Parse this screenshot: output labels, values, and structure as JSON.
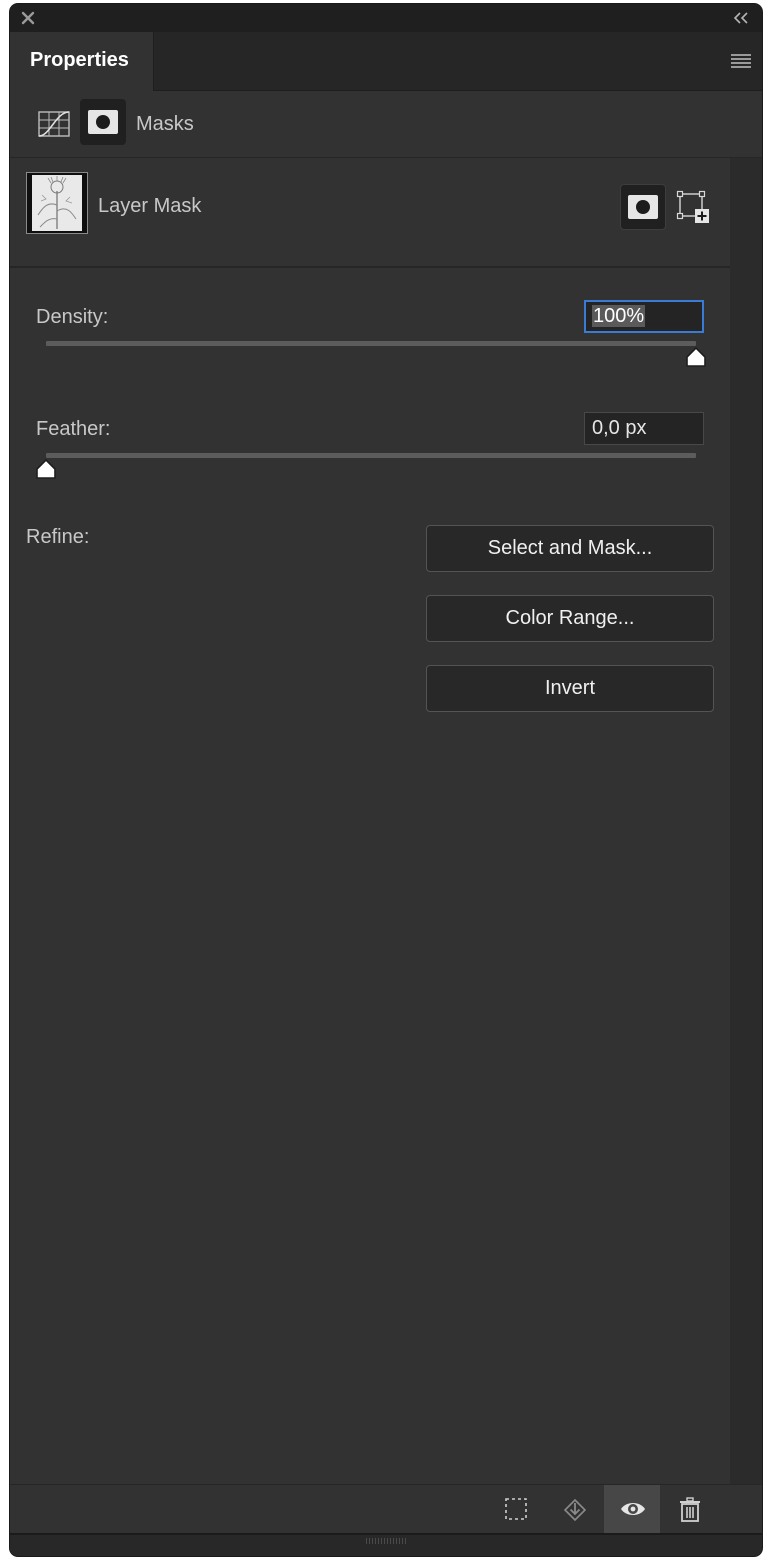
{
  "panel": {
    "tab_title": "Properties",
    "section_label": "Masks"
  },
  "icons": {
    "close": "close-icon",
    "collapse": "double-chevron-left-icon",
    "menu": "hamburger-menu-icon",
    "adjustments": "curves-adjustment-icon",
    "pixel_mask": "pixel-mask-icon",
    "vector_mask": "vector-mask-add-icon",
    "load_selection": "load-selection-icon",
    "apply_mask": "apply-mask-icon",
    "visibility": "eye-icon",
    "delete": "trash-icon"
  },
  "layer": {
    "label": "Layer Mask"
  },
  "density": {
    "label": "Density:",
    "value": "100%",
    "fraction": 1.0
  },
  "feather": {
    "label": "Feather:",
    "value": "0,0 px",
    "fraction": 0.0
  },
  "refine": {
    "label": "Refine:",
    "buttons": [
      "Select and Mask...",
      "Color Range...",
      "Invert"
    ]
  },
  "colors": {
    "panel_bg": "#323232",
    "focus_ring": "#3a7bd5"
  }
}
